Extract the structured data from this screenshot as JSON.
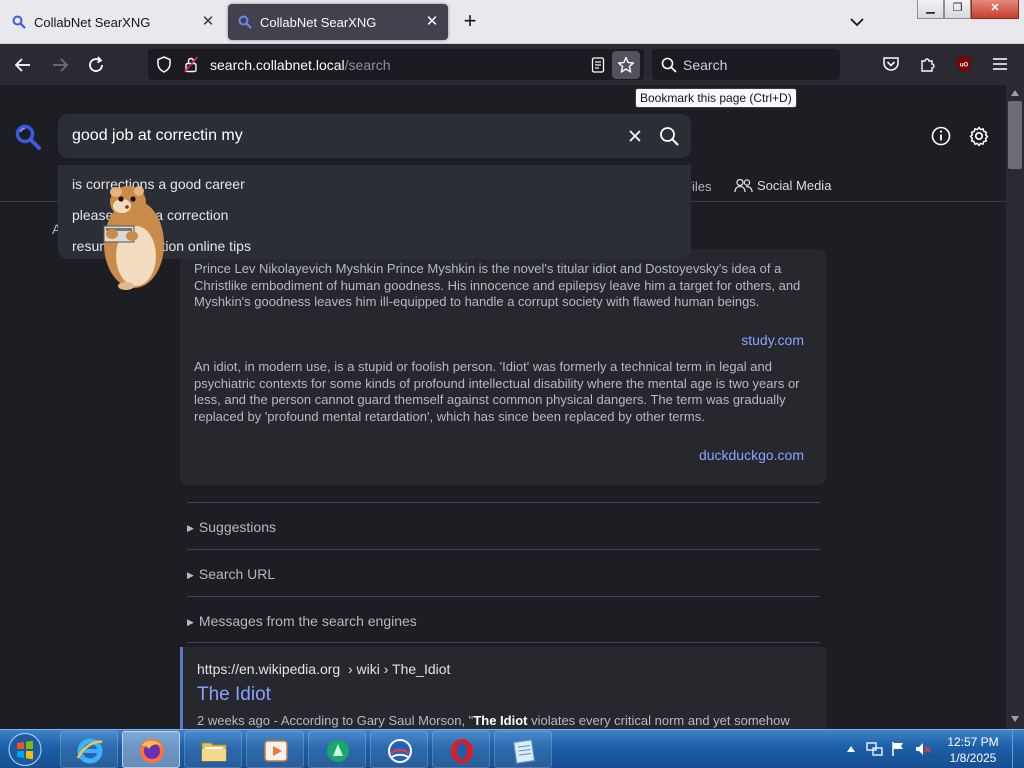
{
  "browser": {
    "tabs": [
      {
        "title": "CollabNet SearXNG",
        "active": false
      },
      {
        "title": "CollabNet SearXNG",
        "active": true
      }
    ],
    "url_host": "search.collabnet.local",
    "url_path": "/search",
    "search_placeholder": "Search",
    "tooltip": "Bookmark this page (Ctrl+D)"
  },
  "search": {
    "query": "good job at correctin my",
    "suggestions": [
      "is corrections a good career",
      "please make a correction",
      "resume correction online tips"
    ]
  },
  "categories": {
    "files": "Files",
    "social": "Social Media"
  },
  "infobox": {
    "paragraph1": "Prince Lev Nikolayevich Myshkin Prince Myshkin is the novel's titular idiot and Dostoyevsky's idea of a Christlike embodiment of human goodness. His innocence and epilepsy leave him a target for others, and Myshkin's goodness leaves him ill-equipped to handle a corrupt society with flawed human beings.",
    "source1": "study.com",
    "paragraph2": "An idiot, in modern use, is a stupid or foolish person. 'Idiot' was formerly a technical term in legal and psychiatric contexts for some kinds of profound intellectual disability where the mental age is two years or less, and the person cannot guard themself against common physical dangers. The term was gradually replaced by 'profound mental retardation', which has since been replaced by other terms.",
    "source2": "duckduckgo.com"
  },
  "details": [
    {
      "label": "Suggestions"
    },
    {
      "label": "Search URL"
    },
    {
      "label": "Messages from the search engines"
    }
  ],
  "result": {
    "url_host": "https://en.wikipedia.org",
    "url_path": "› wiki › The_Idiot",
    "title": "The Idiot",
    "snippet_prefix": "2 weeks ago - According to Gary Saul Morson, \"",
    "snippet_bold": "The Idiot",
    "snippet_suffix": " violates every critical norm and yet somehow"
  },
  "taskbar": {
    "time": "12:57 PM",
    "date": "1/8/2025"
  },
  "colors": {
    "accent": "#8aa2ff",
    "logo": "#3d5ae6",
    "page_bg": "#1d1e23"
  }
}
